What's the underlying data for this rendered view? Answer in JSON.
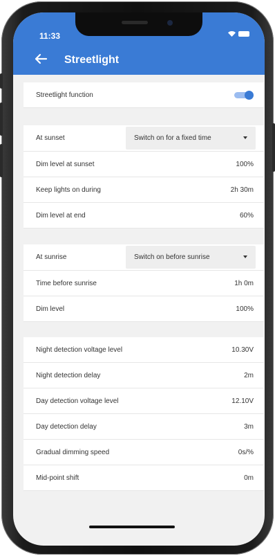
{
  "status_bar": {
    "time": "11:33"
  },
  "header": {
    "title": "Streetlight"
  },
  "function": {
    "label": "Streetlight function",
    "enabled": true
  },
  "sunset": {
    "label": "At sunset",
    "selected": "Switch on for a fixed time",
    "rows": [
      {
        "label": "Dim level at sunset",
        "value": "100%"
      },
      {
        "label": "Keep lights on during",
        "value": "2h 30m"
      },
      {
        "label": "Dim level at end",
        "value": "60%"
      }
    ]
  },
  "sunrise": {
    "label": "At sunrise",
    "selected": "Switch on before sunrise",
    "rows": [
      {
        "label": "Time before sunrise",
        "value": "1h 0m"
      },
      {
        "label": "Dim level",
        "value": "100%"
      }
    ]
  },
  "detection": {
    "rows": [
      {
        "label": "Night detection voltage level",
        "value": "10.30V"
      },
      {
        "label": "Night detection delay",
        "value": "2m"
      },
      {
        "label": "Day detection voltage level",
        "value": "12.10V"
      },
      {
        "label": "Day detection delay",
        "value": "3m"
      },
      {
        "label": "Gradual dimming speed",
        "value": "0s/%"
      },
      {
        "label": "Mid-point shift",
        "value": "0m"
      }
    ]
  },
  "colors": {
    "accent": "#3a7bd5",
    "background": "#f1f1f1",
    "row_background": "#ffffff",
    "select_background": "#eeeeee"
  }
}
